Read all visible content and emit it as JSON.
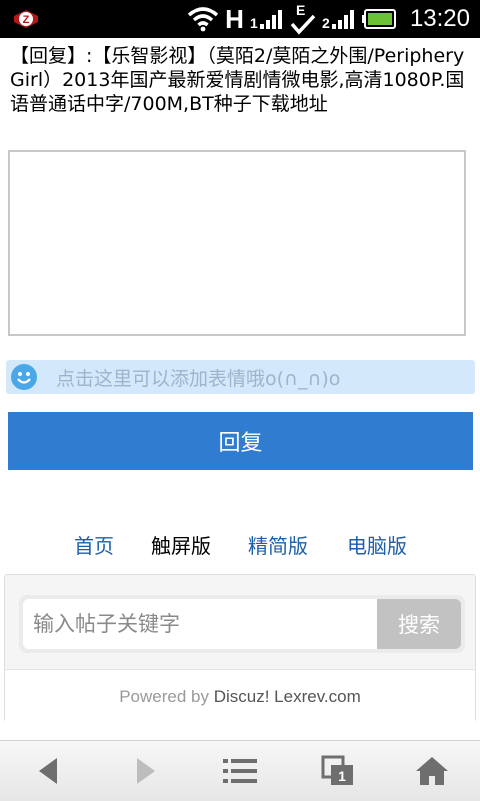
{
  "status_bar": {
    "time": "13:20",
    "network_label": "H",
    "network_label_2": "E",
    "icons": [
      "app-z-icon",
      "wifi-icon",
      "signal-icon",
      "check-icon",
      "signal-2-icon",
      "battery-icon"
    ]
  },
  "post": {
    "title": "【回复】:【乐智影视】（莫陌2/莫陌之外围/Periphery Girl）2013年国产最新爱情剧情微电影,高清1080P.国语普通话中字/700M,BT种子下载地址"
  },
  "reply": {
    "textarea_value": "",
    "emoji_hint": "点击这里可以添加表情哦o(∩_∩)o",
    "submit_label": "回复"
  },
  "footer_nav": {
    "items": [
      {
        "label": "首页"
      },
      {
        "label": "触屏版"
      },
      {
        "label": "精简版"
      },
      {
        "label": "电脑版"
      }
    ]
  },
  "search": {
    "placeholder": "输入帖子关键字",
    "button_label": "搜索"
  },
  "powered": {
    "prefix": "Powered by ",
    "brand": "Discuz! Lexrev.com"
  },
  "toolbar": {
    "icons": [
      "back-icon",
      "forward-icon",
      "menu-icon",
      "tabs-icon",
      "home-icon"
    ],
    "tabs_count": "1"
  },
  "colors": {
    "accent": "#2f7cd0",
    "link": "#1f5fa8",
    "emoji_bar": "#d4e8fb"
  }
}
